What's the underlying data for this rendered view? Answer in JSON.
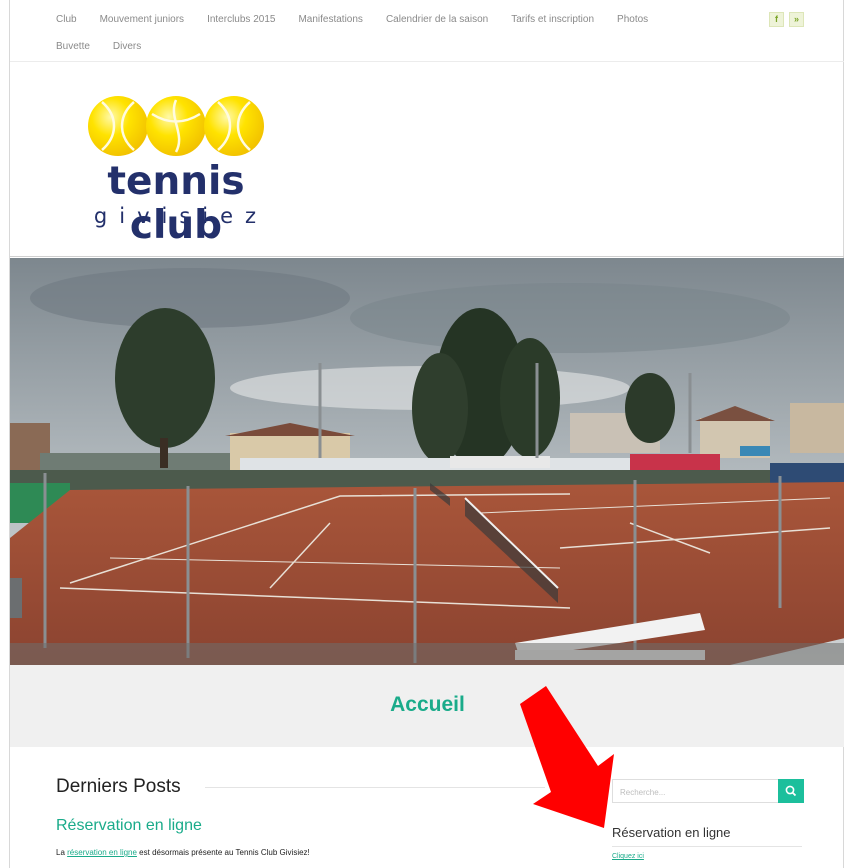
{
  "nav": {
    "row1": [
      "Club",
      "Mouvement juniors",
      "Interclubs 2015",
      "Manifestations",
      "Calendrier de la saison",
      "Tarifs et inscription",
      "Photos"
    ],
    "row2": [
      "Buvette",
      "Divers"
    ],
    "social": [
      {
        "icon": "facebook-icon",
        "glyph": "f"
      },
      {
        "icon": "twitter-icon",
        "glyph": "»"
      }
    ]
  },
  "logo": {
    "title": "tennis club",
    "subtitle": "givisiez",
    "brand_color": "#23306b",
    "ball_color": "#ffe300"
  },
  "hero": {
    "subject": "clay-tennis-courts-panorama"
  },
  "page": {
    "title": "Accueil",
    "accent_color": "#1aab8a"
  },
  "posts": {
    "heading": "Derniers Posts",
    "items": [
      {
        "title": "Réservation en ligne",
        "text_before": "La ",
        "link": "réservation en ligne",
        "text_after": " est désormais présente au Tennis Club Givisiez!"
      }
    ]
  },
  "sidebar": {
    "search_placeholder": "Recherche...",
    "search_icon": "search-icon",
    "widget_title": "Réservation en ligne",
    "widget_link": "Cliquez ici"
  },
  "annotation": {
    "icon": "red-arrow-icon",
    "color": "#ff0000"
  }
}
